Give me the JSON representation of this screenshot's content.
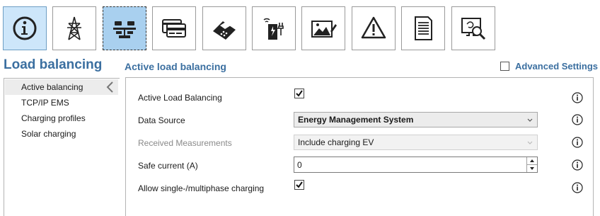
{
  "toolbar": {
    "buttons": [
      {
        "name": "info",
        "icon": "info-icon"
      },
      {
        "name": "grid",
        "icon": "power-tower-icon"
      },
      {
        "name": "load-balancing",
        "icon": "balance-scale-icon"
      },
      {
        "name": "payment",
        "icon": "credit-card-icon"
      },
      {
        "name": "rfid",
        "icon": "card-reader-icon"
      },
      {
        "name": "charging-station",
        "icon": "ev-charger-icon"
      },
      {
        "name": "display",
        "icon": "image-edit-icon"
      },
      {
        "name": "warnings",
        "icon": "warning-icon"
      },
      {
        "name": "log",
        "icon": "document-icon"
      },
      {
        "name": "diagnostics",
        "icon": "monitor-search-icon"
      }
    ]
  },
  "page": {
    "title": "Load balancing"
  },
  "section": {
    "title": "Active load balancing"
  },
  "advanced": {
    "label": "Advanced Settings",
    "checked": false
  },
  "nav": {
    "items": [
      {
        "label": "Active balancing",
        "selected": true
      },
      {
        "label": "TCP/IP EMS"
      },
      {
        "label": "Charging profiles"
      },
      {
        "label": "Solar charging"
      }
    ]
  },
  "form": {
    "active_lb": {
      "label": "Active Load Balancing",
      "checked": true
    },
    "data_source": {
      "label": "Data Source",
      "value": "Energy Management System"
    },
    "received": {
      "label": "Received Measurements",
      "value": "Include charging EV",
      "disabled": true
    },
    "safe_current": {
      "label": "Safe current (A)",
      "value": "0"
    },
    "multiphase": {
      "label": "Allow single-/multiphase charging",
      "checked": true
    }
  },
  "colors": {
    "accent": "#3b6fa0",
    "active_button": "#cde6fa",
    "pressed_button": "#a9d0ef"
  }
}
